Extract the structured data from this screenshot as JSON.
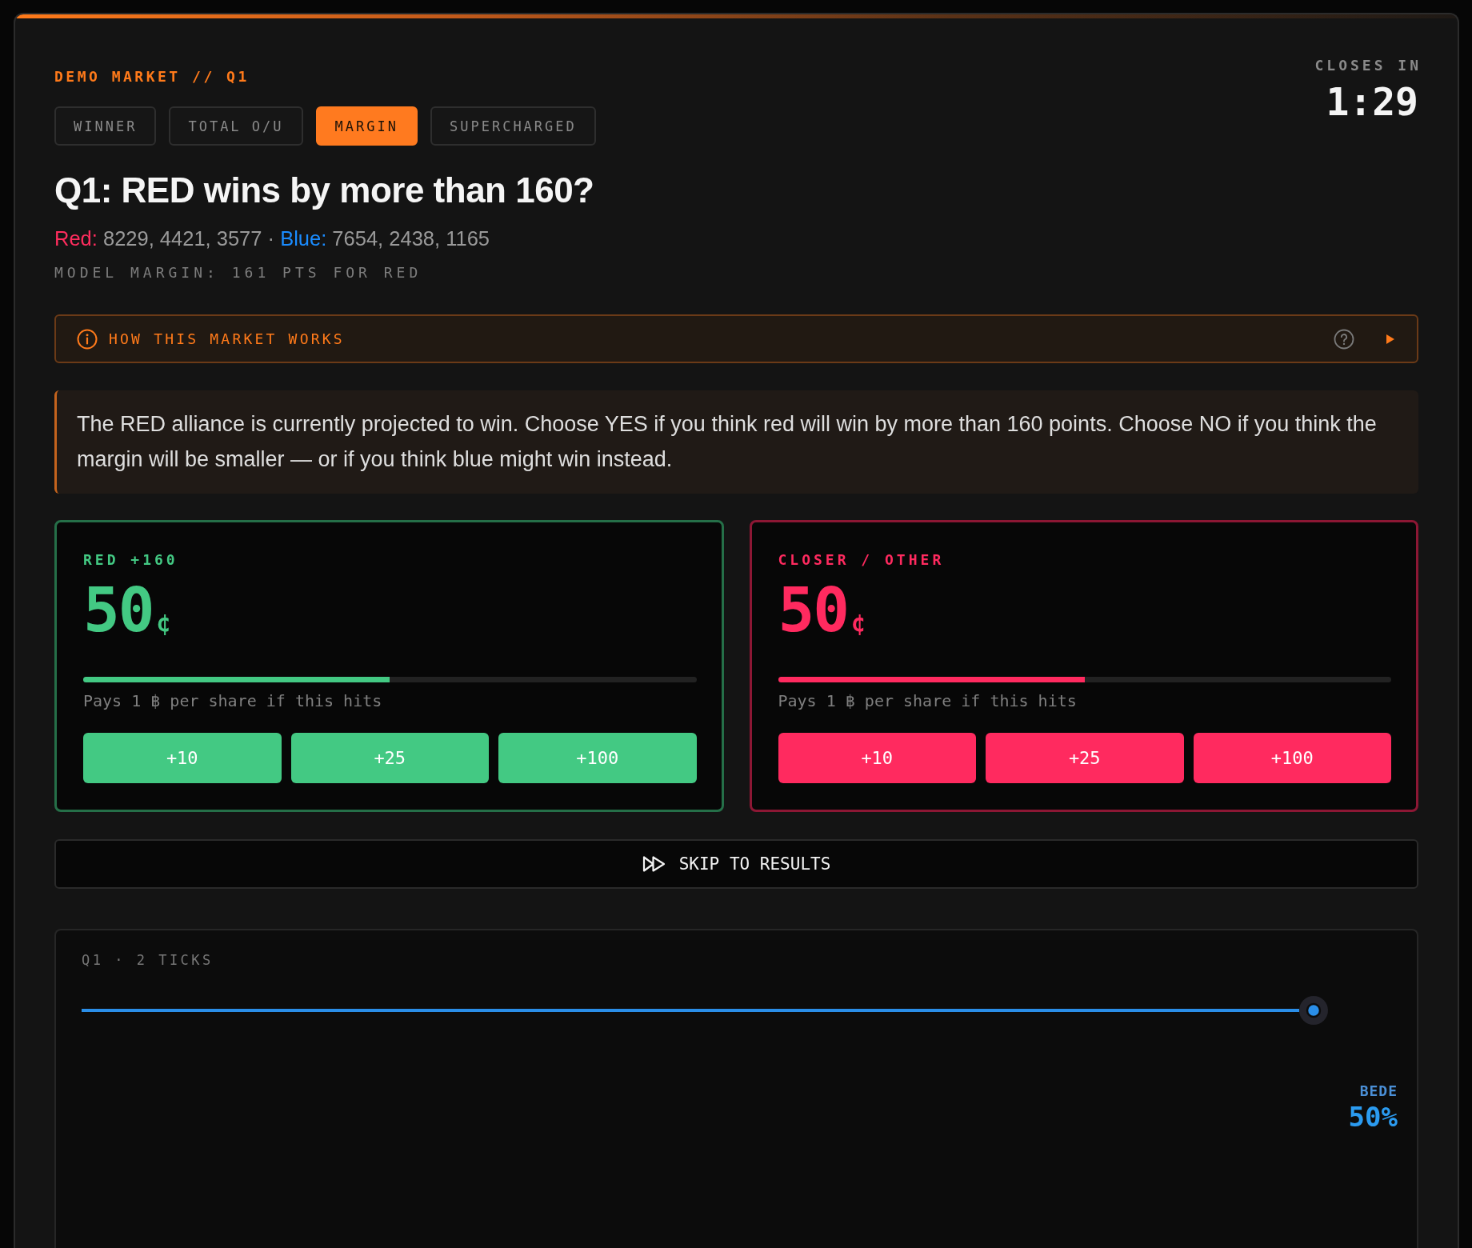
{
  "header": {
    "eyebrow": "DEMO MARKET // Q1",
    "countdown_label": "CLOSES IN",
    "countdown": "1:29"
  },
  "tabs": [
    {
      "label": "WINNER",
      "selected": false
    },
    {
      "label": "TOTAL O/U",
      "selected": false
    },
    {
      "label": "MARGIN",
      "selected": true
    },
    {
      "label": "SUPERCHARGED",
      "selected": false
    }
  ],
  "question": {
    "title": "Q1: RED wins by more than 160?",
    "scores": [
      {
        "label": "Red:",
        "values": "8229, 4421, 3577",
        "color": "#ff2d5e"
      },
      {
        "label": "Blue:",
        "values": "7654, 2438, 1165",
        "color": "#1a8cff"
      }
    ],
    "score_separator": "·",
    "model_margin": "MODEL MARGIN: 161 PTS FOR RED"
  },
  "how_it_works": {
    "label": "HOW THIS MARKET WORKS",
    "expanded": false
  },
  "explanation": "The RED alliance is currently projected to win. Choose YES if you think red will win by more than 160 points. Choose NO if you think the margin will be smaller — or if you think blue might win instead.",
  "outcomes": [
    {
      "label": "RED +160",
      "price": "50",
      "unit": "¢",
      "level": 0.5,
      "note": "Pays 1 ฿ per share if this hits",
      "color": "#43c983",
      "buttons": [
        "+10",
        "+25",
        "+100"
      ]
    },
    {
      "label": "CLOSER / OTHER",
      "price": "50",
      "unit": "¢",
      "level": 0.5,
      "note": "Pays 1 ฿ per share if this hits",
      "color": "#ff2a5f",
      "buttons": [
        "+10",
        "+25",
        "+100"
      ]
    }
  ],
  "skip_button": {
    "label": "SKIP TO RESULTS"
  },
  "tick_chart": {
    "title": "Q1 · 2 TICKS",
    "series_label": "BEDE",
    "series_value": "50%"
  }
}
